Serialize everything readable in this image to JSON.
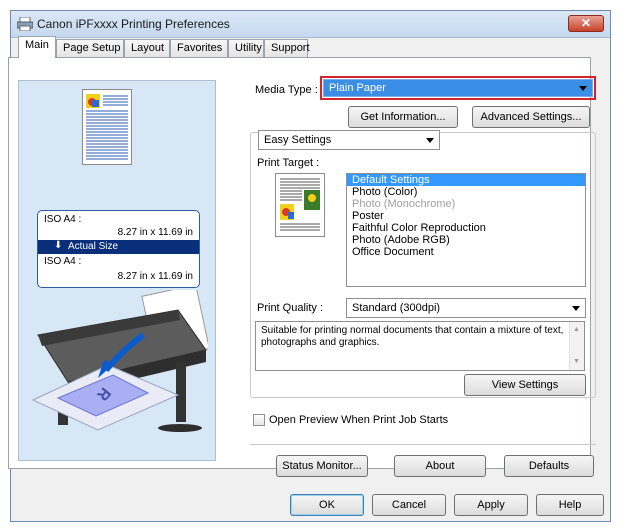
{
  "window": {
    "title": "Canon iPFxxxx Printing Preferences",
    "close_glyph": "✕"
  },
  "tabs": [
    {
      "label": "Main"
    },
    {
      "label": "Page Setup"
    },
    {
      "label": "Layout"
    },
    {
      "label": "Favorites"
    },
    {
      "label": "Utility"
    },
    {
      "label": "Support"
    }
  ],
  "preview": {
    "original_label": "ISO A4 :",
    "original_size": "8.27 in x 11.69 in",
    "scale_label": "Actual Size",
    "output_label": "ISO A4 :",
    "output_size": "8.27 in x 11.69 in"
  },
  "media_type": {
    "label": "Media Type :",
    "value": "Plain Paper"
  },
  "buttons": {
    "get_information": "Get Information...",
    "advanced_settings": "Advanced Settings...",
    "view_settings": "View Settings",
    "status_monitor": "Status Monitor...",
    "about": "About",
    "defaults": "Defaults",
    "ok": "OK",
    "cancel": "Cancel",
    "apply": "Apply",
    "help": "Help"
  },
  "settings_mode": {
    "value": "Easy Settings"
  },
  "print_target": {
    "label": "Print Target :",
    "items": [
      {
        "label": "Default Settings",
        "state": "selected"
      },
      {
        "label": "Photo (Color)",
        "state": "normal"
      },
      {
        "label": "Photo (Monochrome)",
        "state": "disabled"
      },
      {
        "label": "Poster",
        "state": "normal"
      },
      {
        "label": "Faithful Color Reproduction",
        "state": "normal"
      },
      {
        "label": "Photo (Adobe RGB)",
        "state": "normal"
      },
      {
        "label": "Office Document",
        "state": "normal"
      }
    ]
  },
  "print_quality": {
    "label": "Print Quality :",
    "value": "Standard (300dpi)"
  },
  "description": "Suitable for printing normal documents that contain a mixture of text, photographs and graphics.",
  "preview_checkbox": {
    "label": "Open Preview When Print Job Starts",
    "checked": false
  },
  "colors": {
    "highlight": "#3399ff",
    "accent_frame": "#d6222a",
    "preview_bg": "#d8e7f5"
  }
}
